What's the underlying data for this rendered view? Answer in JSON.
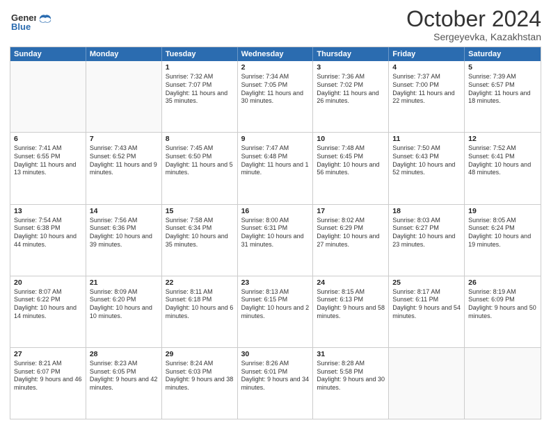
{
  "header": {
    "logo_general": "General",
    "logo_blue": "Blue",
    "month_title": "October 2024",
    "location": "Sergeyevka, Kazakhstan"
  },
  "days_of_week": [
    "Sunday",
    "Monday",
    "Tuesday",
    "Wednesday",
    "Thursday",
    "Friday",
    "Saturday"
  ],
  "weeks": [
    [
      {
        "day": "",
        "sunrise": "",
        "sunset": "",
        "daylight": "",
        "empty": true
      },
      {
        "day": "",
        "sunrise": "",
        "sunset": "",
        "daylight": "",
        "empty": true
      },
      {
        "day": "1",
        "sunrise": "Sunrise: 7:32 AM",
        "sunset": "Sunset: 7:07 PM",
        "daylight": "Daylight: 11 hours and 35 minutes."
      },
      {
        "day": "2",
        "sunrise": "Sunrise: 7:34 AM",
        "sunset": "Sunset: 7:05 PM",
        "daylight": "Daylight: 11 hours and 30 minutes."
      },
      {
        "day": "3",
        "sunrise": "Sunrise: 7:36 AM",
        "sunset": "Sunset: 7:02 PM",
        "daylight": "Daylight: 11 hours and 26 minutes."
      },
      {
        "day": "4",
        "sunrise": "Sunrise: 7:37 AM",
        "sunset": "Sunset: 7:00 PM",
        "daylight": "Daylight: 11 hours and 22 minutes."
      },
      {
        "day": "5",
        "sunrise": "Sunrise: 7:39 AM",
        "sunset": "Sunset: 6:57 PM",
        "daylight": "Daylight: 11 hours and 18 minutes."
      }
    ],
    [
      {
        "day": "6",
        "sunrise": "Sunrise: 7:41 AM",
        "sunset": "Sunset: 6:55 PM",
        "daylight": "Daylight: 11 hours and 13 minutes."
      },
      {
        "day": "7",
        "sunrise": "Sunrise: 7:43 AM",
        "sunset": "Sunset: 6:52 PM",
        "daylight": "Daylight: 11 hours and 9 minutes."
      },
      {
        "day": "8",
        "sunrise": "Sunrise: 7:45 AM",
        "sunset": "Sunset: 6:50 PM",
        "daylight": "Daylight: 11 hours and 5 minutes."
      },
      {
        "day": "9",
        "sunrise": "Sunrise: 7:47 AM",
        "sunset": "Sunset: 6:48 PM",
        "daylight": "Daylight: 11 hours and 1 minute."
      },
      {
        "day": "10",
        "sunrise": "Sunrise: 7:48 AM",
        "sunset": "Sunset: 6:45 PM",
        "daylight": "Daylight: 10 hours and 56 minutes."
      },
      {
        "day": "11",
        "sunrise": "Sunrise: 7:50 AM",
        "sunset": "Sunset: 6:43 PM",
        "daylight": "Daylight: 10 hours and 52 minutes."
      },
      {
        "day": "12",
        "sunrise": "Sunrise: 7:52 AM",
        "sunset": "Sunset: 6:41 PM",
        "daylight": "Daylight: 10 hours and 48 minutes."
      }
    ],
    [
      {
        "day": "13",
        "sunrise": "Sunrise: 7:54 AM",
        "sunset": "Sunset: 6:38 PM",
        "daylight": "Daylight: 10 hours and 44 minutes."
      },
      {
        "day": "14",
        "sunrise": "Sunrise: 7:56 AM",
        "sunset": "Sunset: 6:36 PM",
        "daylight": "Daylight: 10 hours and 39 minutes."
      },
      {
        "day": "15",
        "sunrise": "Sunrise: 7:58 AM",
        "sunset": "Sunset: 6:34 PM",
        "daylight": "Daylight: 10 hours and 35 minutes."
      },
      {
        "day": "16",
        "sunrise": "Sunrise: 8:00 AM",
        "sunset": "Sunset: 6:31 PM",
        "daylight": "Daylight: 10 hours and 31 minutes."
      },
      {
        "day": "17",
        "sunrise": "Sunrise: 8:02 AM",
        "sunset": "Sunset: 6:29 PM",
        "daylight": "Daylight: 10 hours and 27 minutes."
      },
      {
        "day": "18",
        "sunrise": "Sunrise: 8:03 AM",
        "sunset": "Sunset: 6:27 PM",
        "daylight": "Daylight: 10 hours and 23 minutes."
      },
      {
        "day": "19",
        "sunrise": "Sunrise: 8:05 AM",
        "sunset": "Sunset: 6:24 PM",
        "daylight": "Daylight: 10 hours and 19 minutes."
      }
    ],
    [
      {
        "day": "20",
        "sunrise": "Sunrise: 8:07 AM",
        "sunset": "Sunset: 6:22 PM",
        "daylight": "Daylight: 10 hours and 14 minutes."
      },
      {
        "day": "21",
        "sunrise": "Sunrise: 8:09 AM",
        "sunset": "Sunset: 6:20 PM",
        "daylight": "Daylight: 10 hours and 10 minutes."
      },
      {
        "day": "22",
        "sunrise": "Sunrise: 8:11 AM",
        "sunset": "Sunset: 6:18 PM",
        "daylight": "Daylight: 10 hours and 6 minutes."
      },
      {
        "day": "23",
        "sunrise": "Sunrise: 8:13 AM",
        "sunset": "Sunset: 6:15 PM",
        "daylight": "Daylight: 10 hours and 2 minutes."
      },
      {
        "day": "24",
        "sunrise": "Sunrise: 8:15 AM",
        "sunset": "Sunset: 6:13 PM",
        "daylight": "Daylight: 9 hours and 58 minutes."
      },
      {
        "day": "25",
        "sunrise": "Sunrise: 8:17 AM",
        "sunset": "Sunset: 6:11 PM",
        "daylight": "Daylight: 9 hours and 54 minutes."
      },
      {
        "day": "26",
        "sunrise": "Sunrise: 8:19 AM",
        "sunset": "Sunset: 6:09 PM",
        "daylight": "Daylight: 9 hours and 50 minutes."
      }
    ],
    [
      {
        "day": "27",
        "sunrise": "Sunrise: 8:21 AM",
        "sunset": "Sunset: 6:07 PM",
        "daylight": "Daylight: 9 hours and 46 minutes."
      },
      {
        "day": "28",
        "sunrise": "Sunrise: 8:23 AM",
        "sunset": "Sunset: 6:05 PM",
        "daylight": "Daylight: 9 hours and 42 minutes."
      },
      {
        "day": "29",
        "sunrise": "Sunrise: 8:24 AM",
        "sunset": "Sunset: 6:03 PM",
        "daylight": "Daylight: 9 hours and 38 minutes."
      },
      {
        "day": "30",
        "sunrise": "Sunrise: 8:26 AM",
        "sunset": "Sunset: 6:01 PM",
        "daylight": "Daylight: 9 hours and 34 minutes."
      },
      {
        "day": "31",
        "sunrise": "Sunrise: 8:28 AM",
        "sunset": "Sunset: 5:58 PM",
        "daylight": "Daylight: 9 hours and 30 minutes."
      },
      {
        "day": "",
        "sunrise": "",
        "sunset": "",
        "daylight": "",
        "empty": true
      },
      {
        "day": "",
        "sunrise": "",
        "sunset": "",
        "daylight": "",
        "empty": true
      }
    ]
  ]
}
